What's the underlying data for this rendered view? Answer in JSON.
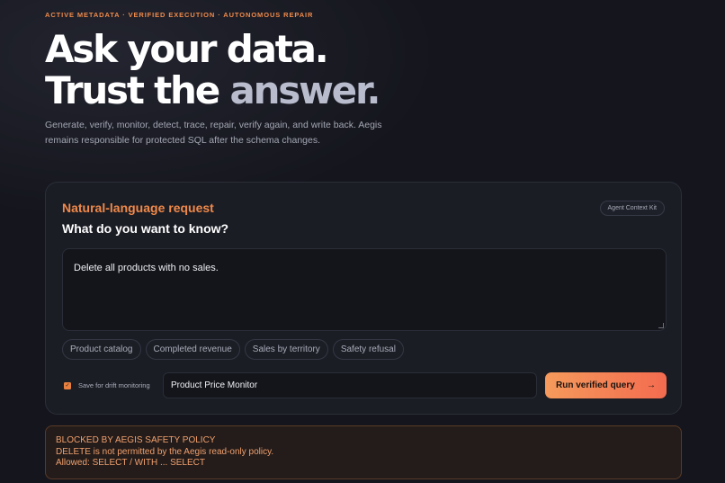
{
  "eyebrow": "ACTIVE METADATA · VERIFIED EXECUTION · AUTONOMOUS REPAIR",
  "hero": {
    "line1": "Ask your data.",
    "line2_start": "Trust the ",
    "line2_dim": "answer."
  },
  "subtitle": "Generate, verify, monitor, detect, trace, repair, verify again, and write back. Aegis remains responsible for protected SQL after the schema changes.",
  "card": {
    "kicker": "Natural-language request",
    "title": "What do you want to know?",
    "kit_label": "Agent Context Kit",
    "prompt_value": "Delete all products with no sales.",
    "chips": [
      "Product catalog",
      "Completed revenue",
      "Sales by territory",
      "Safety refusal"
    ],
    "save_label": "Save for drift monitoring",
    "save_checked": true,
    "monitor_name": "Product Price Monitor",
    "run_label": "Run verified query",
    "run_arrow": "→"
  },
  "alert": {
    "heading": "BLOCKED BY AEGIS SAFETY POLICY",
    "message": "DELETE is not permitted by the Aegis read-only policy.",
    "allowed": "Allowed: SELECT / WITH ... SELECT"
  },
  "colors": {
    "accent": "#f08a4b",
    "button_start": "#f59a5c",
    "button_end": "#f36b4f",
    "alert_text": "#f0a06e"
  }
}
